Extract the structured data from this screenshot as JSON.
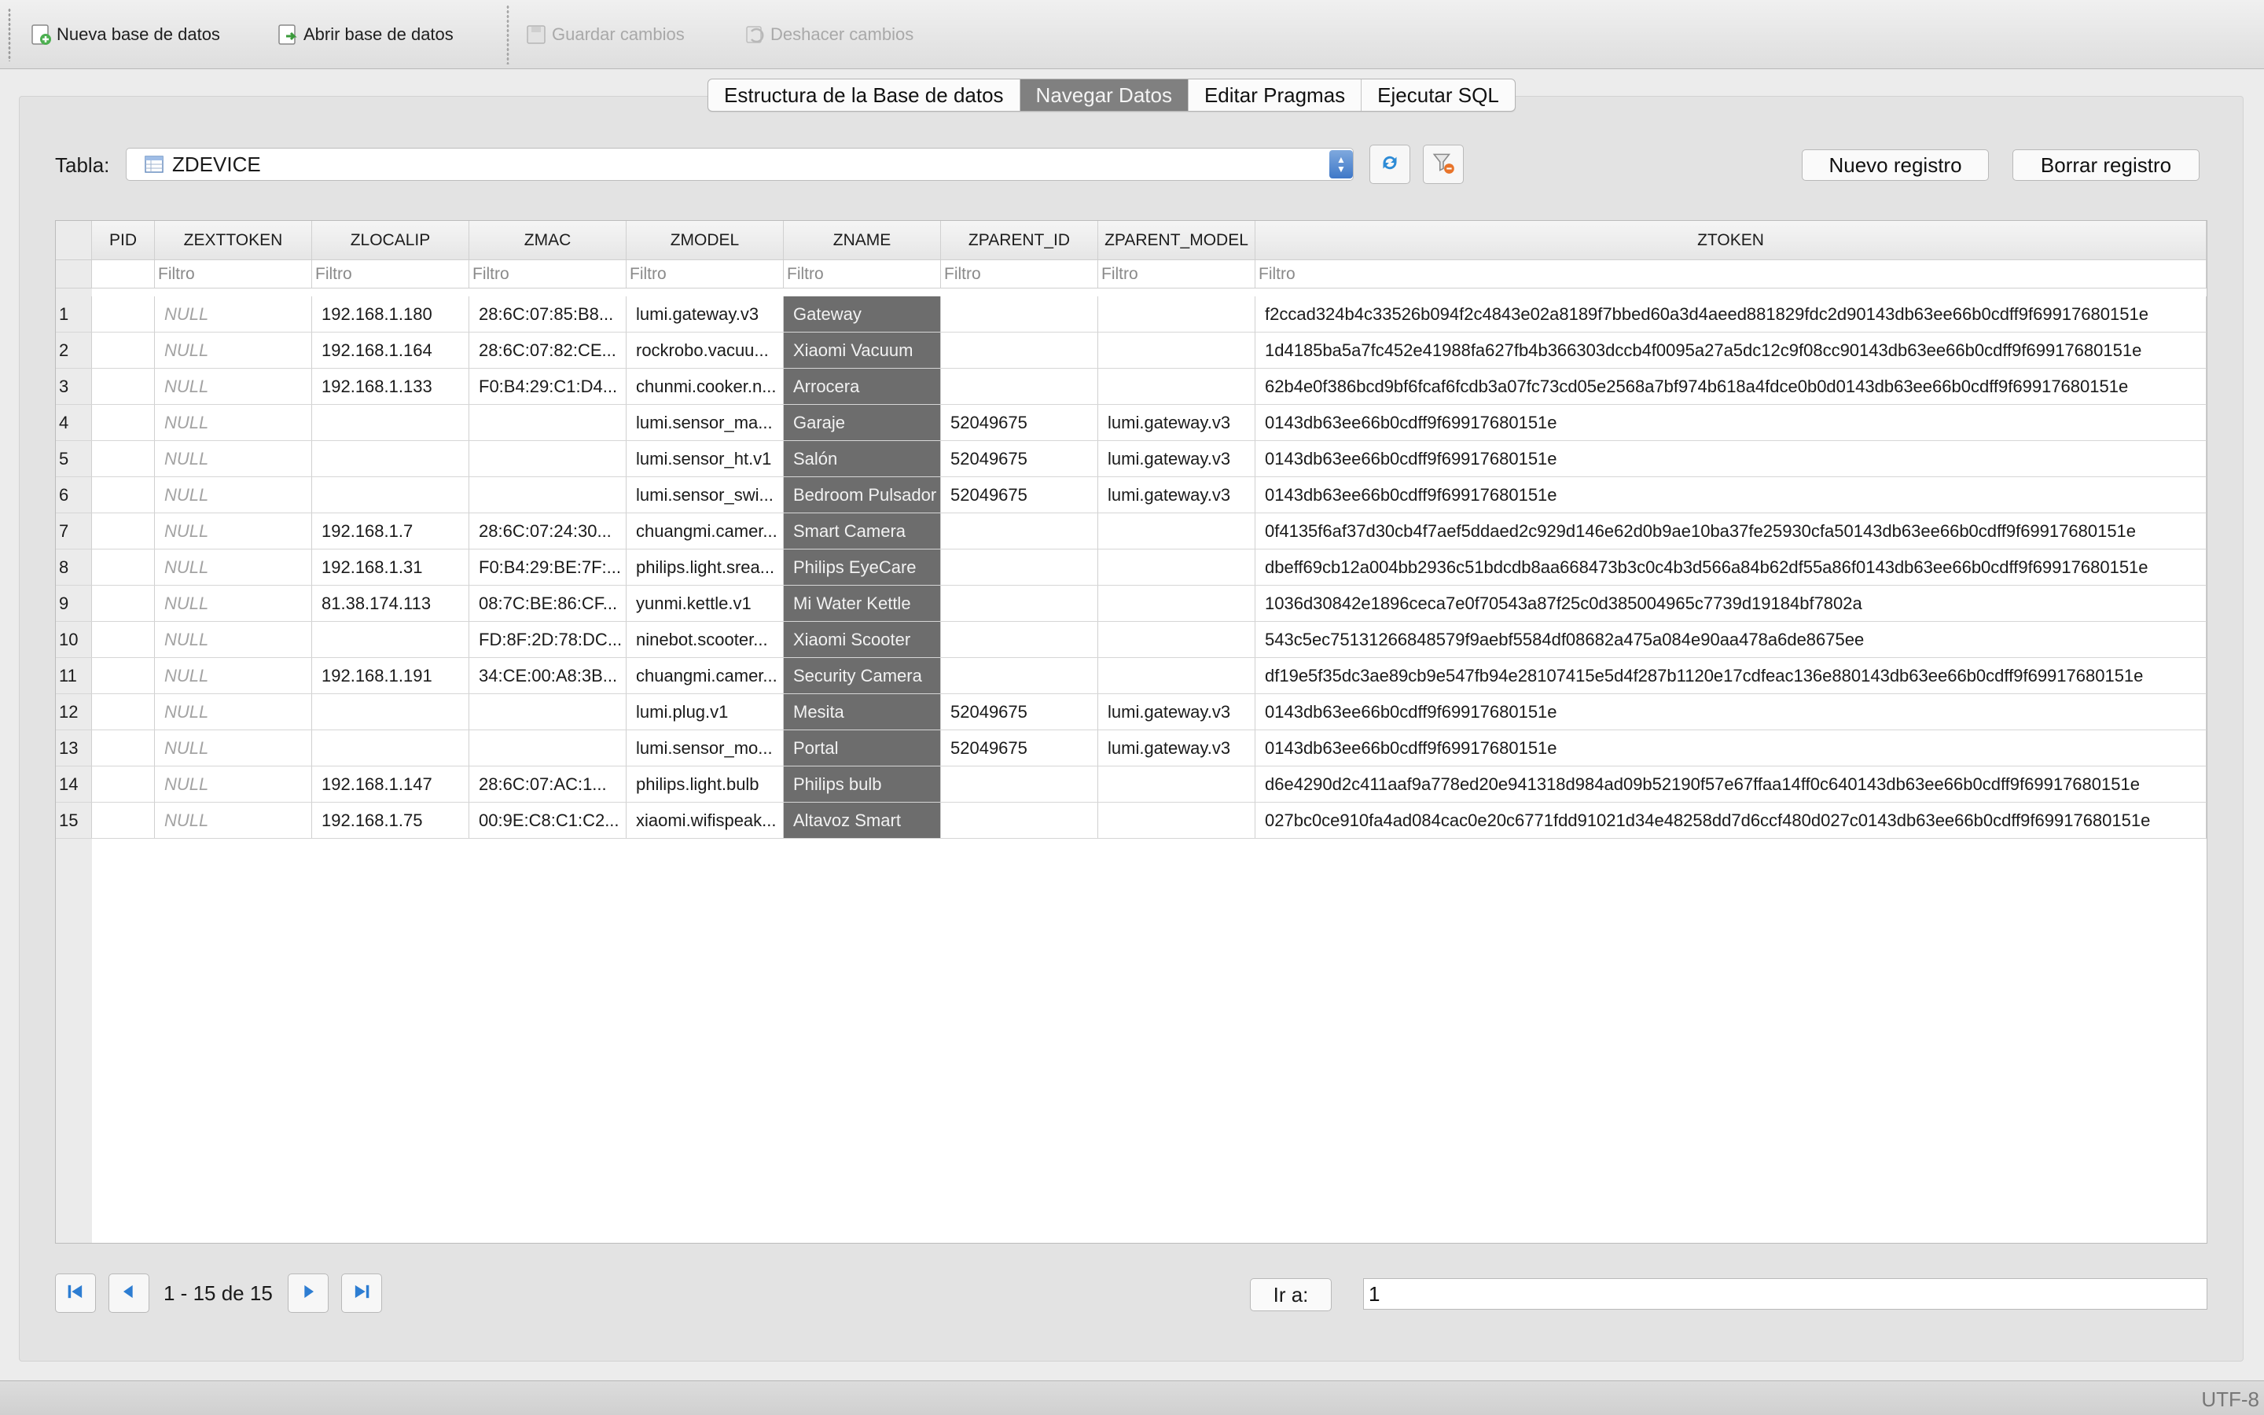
{
  "toolbar": {
    "new_db": "Nueva base de datos",
    "open_db": "Abrir base de datos",
    "save": "Guardar cambios",
    "undo": "Deshacer cambios"
  },
  "tabs": [
    {
      "label": "Estructura de la Base de datos",
      "active": false
    },
    {
      "label": "Navegar Datos",
      "active": true
    },
    {
      "label": "Editar Pragmas",
      "active": false
    },
    {
      "label": "Ejecutar SQL",
      "active": false
    }
  ],
  "table_selector": {
    "label": "Tabla:",
    "value": "ZDEVICE"
  },
  "buttons": {
    "new_record": "Nuevo registro",
    "delete_record": "Borrar registro",
    "goto": "Ir a:"
  },
  "grid": {
    "columns": [
      "PID",
      "ZEXTTOKEN",
      "ZLOCALIP",
      "ZMAC",
      "ZMODEL",
      "ZNAME",
      "ZPARENT_ID",
      "ZPARENT_MODEL",
      "ZTOKEN"
    ],
    "filter_placeholder": "Filtro",
    "null_text": "NULL",
    "rows": [
      {
        "n": "1",
        "pid": "",
        "zexttoken": "NULL",
        "zlocalip": "192.168.1.180",
        "zmac": "28:6C:07:85:B8...",
        "zmodel": "lumi.gateway.v3",
        "zname": "Gateway",
        "zparent_id": "",
        "zparent_model": "",
        "ztoken": "f2ccad324b4c33526b094f2c4843e02a8189f7bbed60a3d4aeed881829fdc2d90143db63ee66b0cdff9f69917680151e"
      },
      {
        "n": "2",
        "pid": "",
        "zexttoken": "NULL",
        "zlocalip": "192.168.1.164",
        "zmac": "28:6C:07:82:CE...",
        "zmodel": "rockrobo.vacuu...",
        "zname": "Xiaomi Vacuum",
        "zparent_id": "",
        "zparent_model": "",
        "ztoken": "1d4185ba5a7fc452e41988fa627fb4b366303dccb4f0095a27a5dc12c9f08cc90143db63ee66b0cdff9f69917680151e"
      },
      {
        "n": "3",
        "pid": "",
        "zexttoken": "NULL",
        "zlocalip": "192.168.1.133",
        "zmac": "F0:B4:29:C1:D4...",
        "zmodel": "chunmi.cooker.n...",
        "zname": "Arrocera",
        "zparent_id": "",
        "zparent_model": "",
        "ztoken": "62b4e0f386bcd9bf6fcaf6fcdb3a07fc73cd05e2568a7bf974b618a4fdce0b0d0143db63ee66b0cdff9f69917680151e"
      },
      {
        "n": "4",
        "pid": "",
        "zexttoken": "NULL",
        "zlocalip": "",
        "zmac": "",
        "zmodel": "lumi.sensor_ma...",
        "zname": "Garaje",
        "zparent_id": "52049675",
        "zparent_model": "lumi.gateway.v3",
        "ztoken": "0143db63ee66b0cdff9f69917680151e"
      },
      {
        "n": "5",
        "pid": "",
        "zexttoken": "NULL",
        "zlocalip": "",
        "zmac": "",
        "zmodel": "lumi.sensor_ht.v1",
        "zname": "Salón",
        "zparent_id": "52049675",
        "zparent_model": "lumi.gateway.v3",
        "ztoken": "0143db63ee66b0cdff9f69917680151e"
      },
      {
        "n": "6",
        "pid": "",
        "zexttoken": "NULL",
        "zlocalip": "",
        "zmac": "",
        "zmodel": "lumi.sensor_swi...",
        "zname": "Bedroom Pulsador",
        "zparent_id": "52049675",
        "zparent_model": "lumi.gateway.v3",
        "ztoken": "0143db63ee66b0cdff9f69917680151e"
      },
      {
        "n": "7",
        "pid": "",
        "zexttoken": "NULL",
        "zlocalip": "192.168.1.7",
        "zmac": "28:6C:07:24:30...",
        "zmodel": "chuangmi.camer...",
        "zname": "Smart Camera",
        "zparent_id": "",
        "zparent_model": "",
        "ztoken": "0f4135f6af37d30cb4f7aef5ddaed2c929d146e62d0b9ae10ba37fe25930cfa50143db63ee66b0cdff9f69917680151e"
      },
      {
        "n": "8",
        "pid": "",
        "zexttoken": "NULL",
        "zlocalip": "192.168.1.31",
        "zmac": "F0:B4:29:BE:7F:...",
        "zmodel": "philips.light.srea...",
        "zname": "Philips EyeCare",
        "zparent_id": "",
        "zparent_model": "",
        "ztoken": "dbeff69cb12a004bb2936c51bdcdb8aa668473b3c0c4b3d566a84b62df55a86f0143db63ee66b0cdff9f69917680151e"
      },
      {
        "n": "9",
        "pid": "",
        "zexttoken": "NULL",
        "zlocalip": "81.38.174.113",
        "zmac": "08:7C:BE:86:CF...",
        "zmodel": "yunmi.kettle.v1",
        "zname": "Mi Water Kettle",
        "zparent_id": "",
        "zparent_model": "",
        "ztoken": "1036d30842e1896ceca7e0f70543a87f25c0d385004965c7739d19184bf7802a"
      },
      {
        "n": "10",
        "pid": "",
        "zexttoken": "NULL",
        "zlocalip": "",
        "zmac": "FD:8F:2D:78:DC...",
        "zmodel": "ninebot.scooter...",
        "zname": "Xiaomi Scooter",
        "zparent_id": "",
        "zparent_model": "",
        "ztoken": "543c5ec75131266848579f9aebf5584df08682a475a084e90aa478a6de8675ee"
      },
      {
        "n": "11",
        "pid": "",
        "zexttoken": "NULL",
        "zlocalip": "192.168.1.191",
        "zmac": "34:CE:00:A8:3B...",
        "zmodel": "chuangmi.camer...",
        "zname": "Security Camera",
        "zparent_id": "",
        "zparent_model": "",
        "ztoken": "df19e5f35dc3ae89cb9e547fb94e28107415e5d4f287b1120e17cdfeac136e880143db63ee66b0cdff9f69917680151e"
      },
      {
        "n": "12",
        "pid": "",
        "zexttoken": "NULL",
        "zlocalip": "",
        "zmac": "",
        "zmodel": "lumi.plug.v1",
        "zname": "Mesita",
        "zparent_id": "52049675",
        "zparent_model": "lumi.gateway.v3",
        "ztoken": "0143db63ee66b0cdff9f69917680151e"
      },
      {
        "n": "13",
        "pid": "",
        "zexttoken": "NULL",
        "zlocalip": "",
        "zmac": "",
        "zmodel": "lumi.sensor_mo...",
        "zname": "Portal",
        "zparent_id": "52049675",
        "zparent_model": "lumi.gateway.v3",
        "ztoken": "0143db63ee66b0cdff9f69917680151e"
      },
      {
        "n": "14",
        "pid": "",
        "zexttoken": "NULL",
        "zlocalip": "192.168.1.147",
        "zmac": "28:6C:07:AC:1...",
        "zmodel": "philips.light.bulb",
        "zname": "Philips bulb",
        "zparent_id": "",
        "zparent_model": "",
        "ztoken": "d6e4290d2c411aaf9a778ed20e941318d984ad09b52190f57e67ffaa14ff0c640143db63ee66b0cdff9f69917680151e"
      },
      {
        "n": "15",
        "pid": "",
        "zexttoken": "NULL",
        "zlocalip": "192.168.1.75",
        "zmac": "00:9E:C8:C1:C2...",
        "zmodel": "xiaomi.wifispeak...",
        "zname": "Altavoz Smart",
        "zparent_id": "",
        "zparent_model": "",
        "ztoken": "027bc0ce910fa4ad084cac0e20c6771fdd91021d34e48258dd7d6ccf480d027c0143db63ee66b0cdff9f69917680151e"
      }
    ]
  },
  "pager": {
    "info": "1 - 15 de 15",
    "goto_value": "1"
  },
  "status": {
    "encoding": "UTF-8"
  },
  "colors": {
    "accent": "#3f78c8",
    "selected_column": "#6d6d6d",
    "active_tab": "#808080"
  }
}
